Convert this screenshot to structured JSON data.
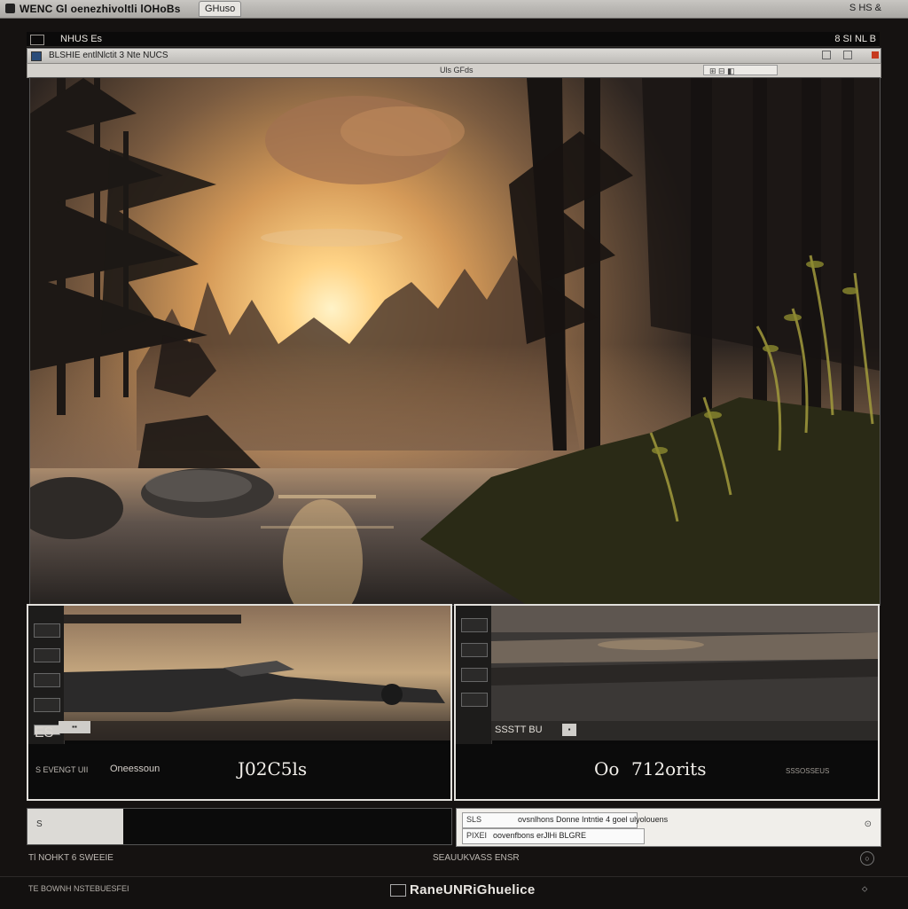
{
  "os_bar": {
    "title": "WENC Gl oenezhivoltli lOHoBs",
    "tab": "GHuso",
    "right": "S  HS  &"
  },
  "app_header": {
    "title": "NHUS Es",
    "right": "8  SI  NL  B"
  },
  "window": {
    "title": "BLSHIE  entlNlctit  3  Nte  NUCS",
    "center_label": "Uls GFds"
  },
  "panel_left": {
    "left_label": "S  EVENGT  UII",
    "mid_label": "Oneessoun",
    "readout": "J02C5ls",
    "tool_label": "ES"
  },
  "panel_right": {
    "image_label": "SSSTT  BU",
    "readout_prefix": "Oo",
    "readout": "712orits",
    "small_label": "SSSOSSEUS"
  },
  "bottom_right": {
    "row1_code": "SLS",
    "row1_text": "ovsnlhons  Donne  Intntie  4 goel  ulyolouens",
    "row2_code": "PIXEI",
    "row2_text": "oovenfbons  erJlHi  BLGRE"
  },
  "bottom_left": {
    "label": "S"
  },
  "status_line": {
    "left": "Tl NOHKT  6  SWEEIE",
    "center": "SEAUUKVASS ENSR"
  },
  "footer": {
    "left": "TE  BOWNH  NSTEBUESFEI",
    "brand": "RaneUNRiGhuelice"
  },
  "colors": {
    "sky_top": "#8d6a42",
    "sun": "#fff0c2",
    "water": "#6a5d54",
    "panel_border": "#e2e0dc",
    "accent_red": "#c63a1f"
  }
}
